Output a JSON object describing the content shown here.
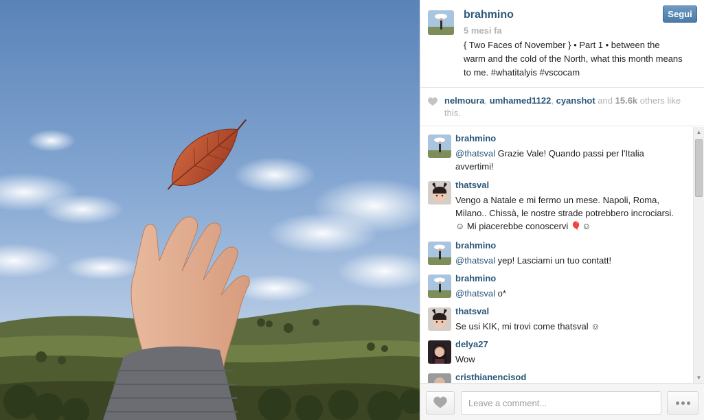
{
  "post": {
    "username": "brahmino",
    "time": "5 mesi fa",
    "caption": "{ Two Faces of November } • Part 1 • between the warm and the cold of the North, what this month means to me. #whatitalyis #vscocam",
    "follow_label": "Segui"
  },
  "likes": {
    "users": [
      "nelmoura",
      "umhamed1122",
      "cyanshot"
    ],
    "and": "and",
    "count": "15.6k",
    "suffix": "others like this."
  },
  "comments": [
    {
      "user": "brahmino",
      "mention": "@thatsval",
      "text": " Grazie Vale! Quando passi per l'Italia avvertimi!",
      "avatar": "brahmino-avatar"
    },
    {
      "user": "thatsval",
      "mention": "",
      "text": "Vengo a Natale e mi fermo un mese. Napoli, Roma, Milano.. Chissà, le nostre strade potrebbero incrociarsi. ☺ Mi piacerebbe conoscervi 🎈☺",
      "avatar": "thatsval-avatar"
    },
    {
      "user": "brahmino",
      "mention": "@thatsval",
      "text": " yep! Lasciami un tuo contatt!",
      "avatar": "brahmino-avatar"
    },
    {
      "user": "brahmino",
      "mention": "@thatsval",
      "text": " o*",
      "avatar": "brahmino-avatar"
    },
    {
      "user": "thatsval",
      "mention": "",
      "text": "Se usi KIK, mi trovi come thatsval ☺",
      "avatar": "thatsval-avatar"
    },
    {
      "user": "delya27",
      "mention": "",
      "text": "Wow",
      "avatar": "delya27-avatar"
    },
    {
      "user": "cristhianencisod",
      "mention": "",
      "text": "",
      "avatar": "cristhianencisod-avatar"
    }
  ],
  "footer": {
    "comment_placeholder": "Leave a comment..."
  },
  "colors": {
    "link": "#2b5779",
    "muted": "#b3b3b3",
    "follow_button": "#5a87b2"
  },
  "icons": [
    "heart-icon",
    "ellipsis-icon",
    "scroll-up-arrow-icon",
    "scroll-down-arrow-icon"
  ]
}
